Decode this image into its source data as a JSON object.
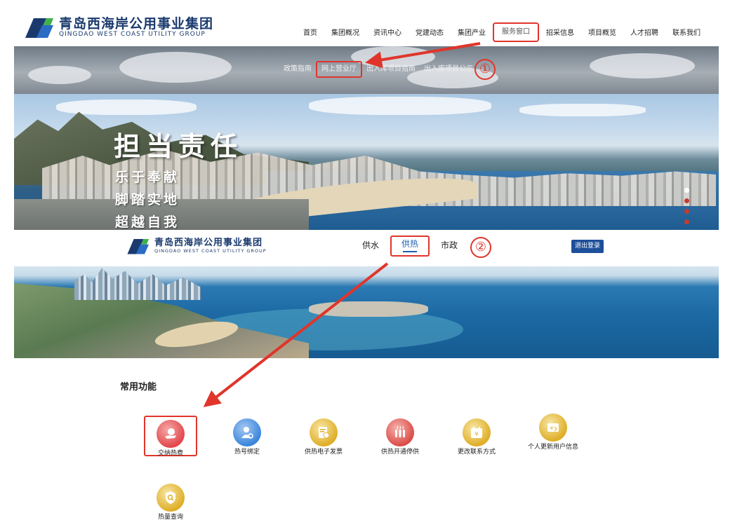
{
  "header": {
    "logo_cn": "青岛西海岸公用事业集团",
    "logo_en": "QINGDAO WEST COAST UTILITY GROUP",
    "nav": [
      "首页",
      "集团概况",
      "资讯中心",
      "党建动态",
      "集团产业",
      "服务窗口",
      "招采信息",
      "项目概览",
      "人才招聘",
      "联系我们"
    ],
    "active_index": 5
  },
  "subnav": {
    "items": [
      "政策指南",
      "网上营业厅",
      "出入库项目指南",
      "出入库项目公示"
    ],
    "highlight_index": 1,
    "step_marker": "①"
  },
  "hero": {
    "slogan_main": "担当责任",
    "slogans": [
      "乐于奉献",
      "脚踏实地",
      "超越自我"
    ]
  },
  "header2": {
    "logo_cn": "青岛西海岸公用事业集团",
    "logo_en": "QINGDAO WEST COAST UTILITY GROUP",
    "tabs": [
      "供水",
      "供热",
      "市政"
    ],
    "active_tab": 1,
    "step_marker": "②",
    "logout_label": "退出登录"
  },
  "functions": {
    "title": "常用功能",
    "items": [
      {
        "label": "交纳热费",
        "icon": "payment-icon",
        "color": "red"
      },
      {
        "label": "热号绑定",
        "icon": "user-link-icon",
        "color": "blue"
      },
      {
        "label": "供热电子发票",
        "icon": "invoice-icon",
        "color": "gold"
      },
      {
        "label": "供热开通停供",
        "icon": "radiator-icon",
        "color": "red"
      },
      {
        "label": "更改联系方式",
        "icon": "calendar-yen-icon",
        "color": "gold"
      },
      {
        "label": "个人更新用户信息",
        "icon": "wallet-yen-icon",
        "color": "gold"
      },
      {
        "label": "热量查询",
        "icon": "search-shield-icon",
        "color": "gold"
      }
    ]
  },
  "colors": {
    "brand_blue": "#1a3a6e",
    "annotation_red": "#e0352b",
    "button_blue": "#1d4f9a"
  }
}
